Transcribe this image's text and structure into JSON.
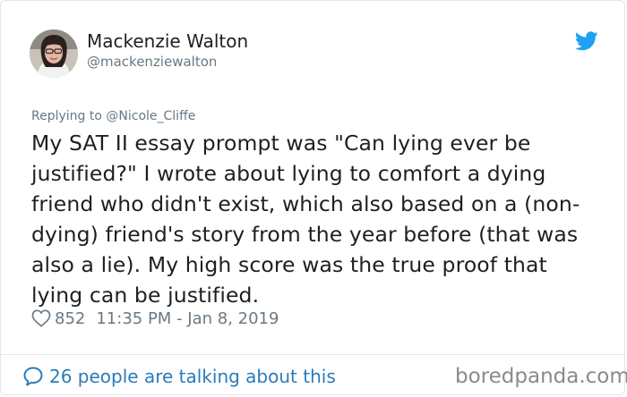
{
  "user": {
    "display_name": "Mackenzie Walton",
    "handle": "@mackenziewalton",
    "avatar": "profile-photo"
  },
  "tweet": {
    "reply_prefix": "Replying to ",
    "reply_mention": "@Nicole_Cliffe",
    "text": "My SAT II essay prompt was \"Can lying ever be justified?\" I wrote about lying to comfort a dying friend who didn't exist, which also based on a (non-dying) friend's story from the year before (that was also a lie). My high score was the true proof that lying can be justified.",
    "likes": "852",
    "timestamp": "11:35 PM - Jan 8, 2019"
  },
  "footer": {
    "talking_text": "26 people are talking about this"
  },
  "watermark": "boredpanda.com",
  "icons": {
    "brand": "twitter-bird-icon",
    "like": "heart-icon",
    "conversation": "speech-bubble-icon"
  },
  "colors": {
    "twitter_blue": "#1da1f2",
    "link_blue": "#2b7bb9",
    "secondary_text": "#697882",
    "primary_text": "#1c2022",
    "border": "#e1e8ed"
  }
}
